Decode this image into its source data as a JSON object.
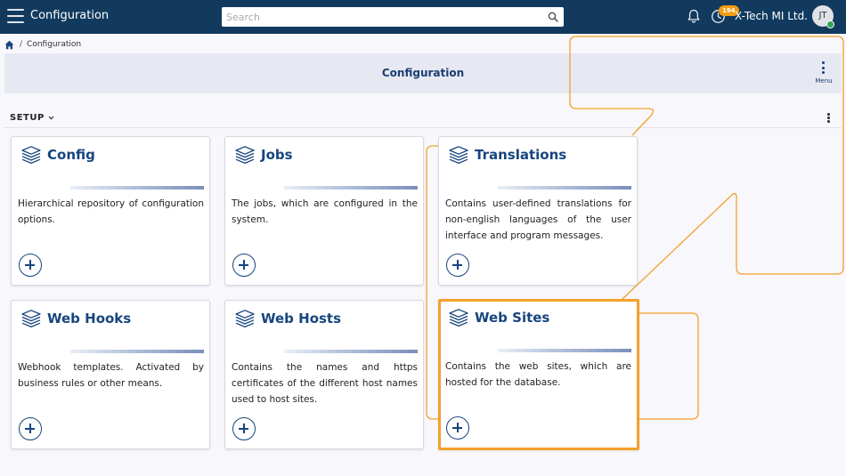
{
  "topbar": {
    "title": "Configuration",
    "search_placeholder": "Search",
    "notification_count": "194",
    "company": "X-Tech MI Ltd.",
    "avatar_initials": "JT"
  },
  "breadcrumb": {
    "items": [
      "Configuration"
    ]
  },
  "header": {
    "title": "Configuration",
    "menu_label": "Menu"
  },
  "section": {
    "label": "SETUP"
  },
  "cards": [
    {
      "title": "Config",
      "description": "Hierarchical repository of configuration options."
    },
    {
      "title": "Jobs",
      "description": "The jobs, which are configured in the system."
    },
    {
      "title": "Translations",
      "description": "Contains user-defined translations for non-english languages of the user interface and program messages."
    },
    {
      "title": "Web Hooks",
      "description": "Webhook templates. Activated by business rules or other means."
    },
    {
      "title": "Web Hosts",
      "description": "Contains the names and https certificates of the different host names used to host sites."
    },
    {
      "title": "Web Sites",
      "description": "Contains the web sites, which are hosted for the database."
    }
  ],
  "colors": {
    "topbar": "#123a5f",
    "accent": "#17457e",
    "highlight": "#f3a12a",
    "badge": "#f39c12",
    "online": "#2ea44f"
  },
  "icons": [
    "menu-icon",
    "search-icon",
    "bell-icon",
    "clock-icon",
    "home-icon",
    "chevron-down-icon",
    "kebab-icon",
    "stack-icon",
    "plus-icon"
  ]
}
